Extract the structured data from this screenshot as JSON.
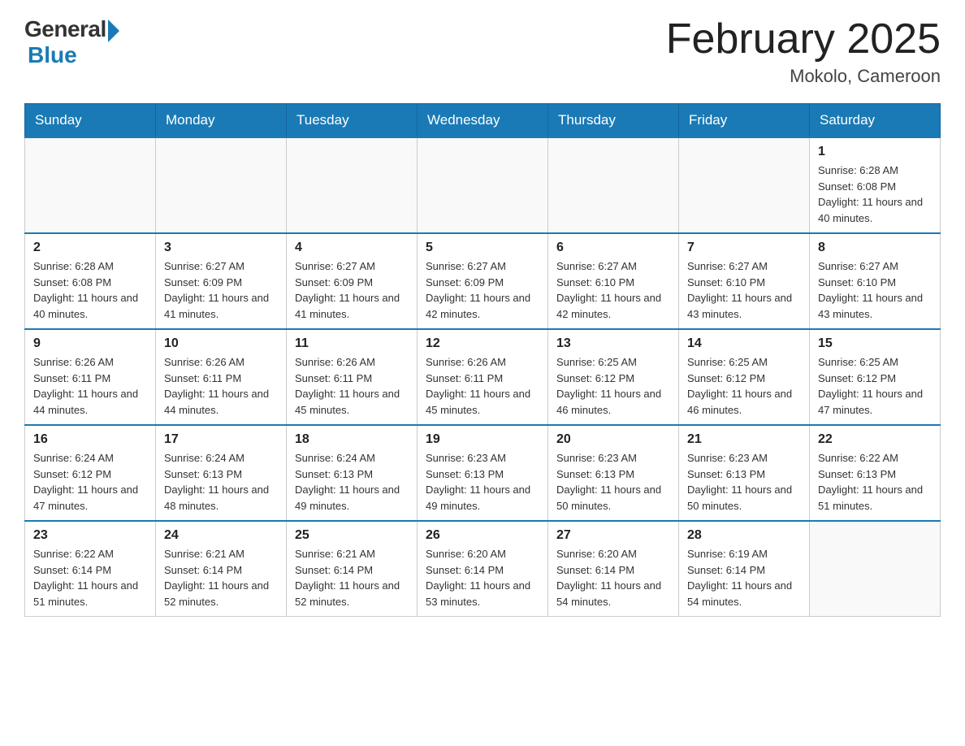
{
  "logo": {
    "general": "General",
    "blue": "Blue"
  },
  "title": "February 2025",
  "subtitle": "Mokolo, Cameroon",
  "days_of_week": [
    "Sunday",
    "Monday",
    "Tuesday",
    "Wednesday",
    "Thursday",
    "Friday",
    "Saturday"
  ],
  "weeks": [
    [
      {
        "day": "",
        "info": ""
      },
      {
        "day": "",
        "info": ""
      },
      {
        "day": "",
        "info": ""
      },
      {
        "day": "",
        "info": ""
      },
      {
        "day": "",
        "info": ""
      },
      {
        "day": "",
        "info": ""
      },
      {
        "day": "1",
        "info": "Sunrise: 6:28 AM\nSunset: 6:08 PM\nDaylight: 11 hours and 40 minutes."
      }
    ],
    [
      {
        "day": "2",
        "info": "Sunrise: 6:28 AM\nSunset: 6:08 PM\nDaylight: 11 hours and 40 minutes."
      },
      {
        "day": "3",
        "info": "Sunrise: 6:27 AM\nSunset: 6:09 PM\nDaylight: 11 hours and 41 minutes."
      },
      {
        "day": "4",
        "info": "Sunrise: 6:27 AM\nSunset: 6:09 PM\nDaylight: 11 hours and 41 minutes."
      },
      {
        "day": "5",
        "info": "Sunrise: 6:27 AM\nSunset: 6:09 PM\nDaylight: 11 hours and 42 minutes."
      },
      {
        "day": "6",
        "info": "Sunrise: 6:27 AM\nSunset: 6:10 PM\nDaylight: 11 hours and 42 minutes."
      },
      {
        "day": "7",
        "info": "Sunrise: 6:27 AM\nSunset: 6:10 PM\nDaylight: 11 hours and 43 minutes."
      },
      {
        "day": "8",
        "info": "Sunrise: 6:27 AM\nSunset: 6:10 PM\nDaylight: 11 hours and 43 minutes."
      }
    ],
    [
      {
        "day": "9",
        "info": "Sunrise: 6:26 AM\nSunset: 6:11 PM\nDaylight: 11 hours and 44 minutes."
      },
      {
        "day": "10",
        "info": "Sunrise: 6:26 AM\nSunset: 6:11 PM\nDaylight: 11 hours and 44 minutes."
      },
      {
        "day": "11",
        "info": "Sunrise: 6:26 AM\nSunset: 6:11 PM\nDaylight: 11 hours and 45 minutes."
      },
      {
        "day": "12",
        "info": "Sunrise: 6:26 AM\nSunset: 6:11 PM\nDaylight: 11 hours and 45 minutes."
      },
      {
        "day": "13",
        "info": "Sunrise: 6:25 AM\nSunset: 6:12 PM\nDaylight: 11 hours and 46 minutes."
      },
      {
        "day": "14",
        "info": "Sunrise: 6:25 AM\nSunset: 6:12 PM\nDaylight: 11 hours and 46 minutes."
      },
      {
        "day": "15",
        "info": "Sunrise: 6:25 AM\nSunset: 6:12 PM\nDaylight: 11 hours and 47 minutes."
      }
    ],
    [
      {
        "day": "16",
        "info": "Sunrise: 6:24 AM\nSunset: 6:12 PM\nDaylight: 11 hours and 47 minutes."
      },
      {
        "day": "17",
        "info": "Sunrise: 6:24 AM\nSunset: 6:13 PM\nDaylight: 11 hours and 48 minutes."
      },
      {
        "day": "18",
        "info": "Sunrise: 6:24 AM\nSunset: 6:13 PM\nDaylight: 11 hours and 49 minutes."
      },
      {
        "day": "19",
        "info": "Sunrise: 6:23 AM\nSunset: 6:13 PM\nDaylight: 11 hours and 49 minutes."
      },
      {
        "day": "20",
        "info": "Sunrise: 6:23 AM\nSunset: 6:13 PM\nDaylight: 11 hours and 50 minutes."
      },
      {
        "day": "21",
        "info": "Sunrise: 6:23 AM\nSunset: 6:13 PM\nDaylight: 11 hours and 50 minutes."
      },
      {
        "day": "22",
        "info": "Sunrise: 6:22 AM\nSunset: 6:13 PM\nDaylight: 11 hours and 51 minutes."
      }
    ],
    [
      {
        "day": "23",
        "info": "Sunrise: 6:22 AM\nSunset: 6:14 PM\nDaylight: 11 hours and 51 minutes."
      },
      {
        "day": "24",
        "info": "Sunrise: 6:21 AM\nSunset: 6:14 PM\nDaylight: 11 hours and 52 minutes."
      },
      {
        "day": "25",
        "info": "Sunrise: 6:21 AM\nSunset: 6:14 PM\nDaylight: 11 hours and 52 minutes."
      },
      {
        "day": "26",
        "info": "Sunrise: 6:20 AM\nSunset: 6:14 PM\nDaylight: 11 hours and 53 minutes."
      },
      {
        "day": "27",
        "info": "Sunrise: 6:20 AM\nSunset: 6:14 PM\nDaylight: 11 hours and 54 minutes."
      },
      {
        "day": "28",
        "info": "Sunrise: 6:19 AM\nSunset: 6:14 PM\nDaylight: 11 hours and 54 minutes."
      },
      {
        "day": "",
        "info": ""
      }
    ]
  ]
}
